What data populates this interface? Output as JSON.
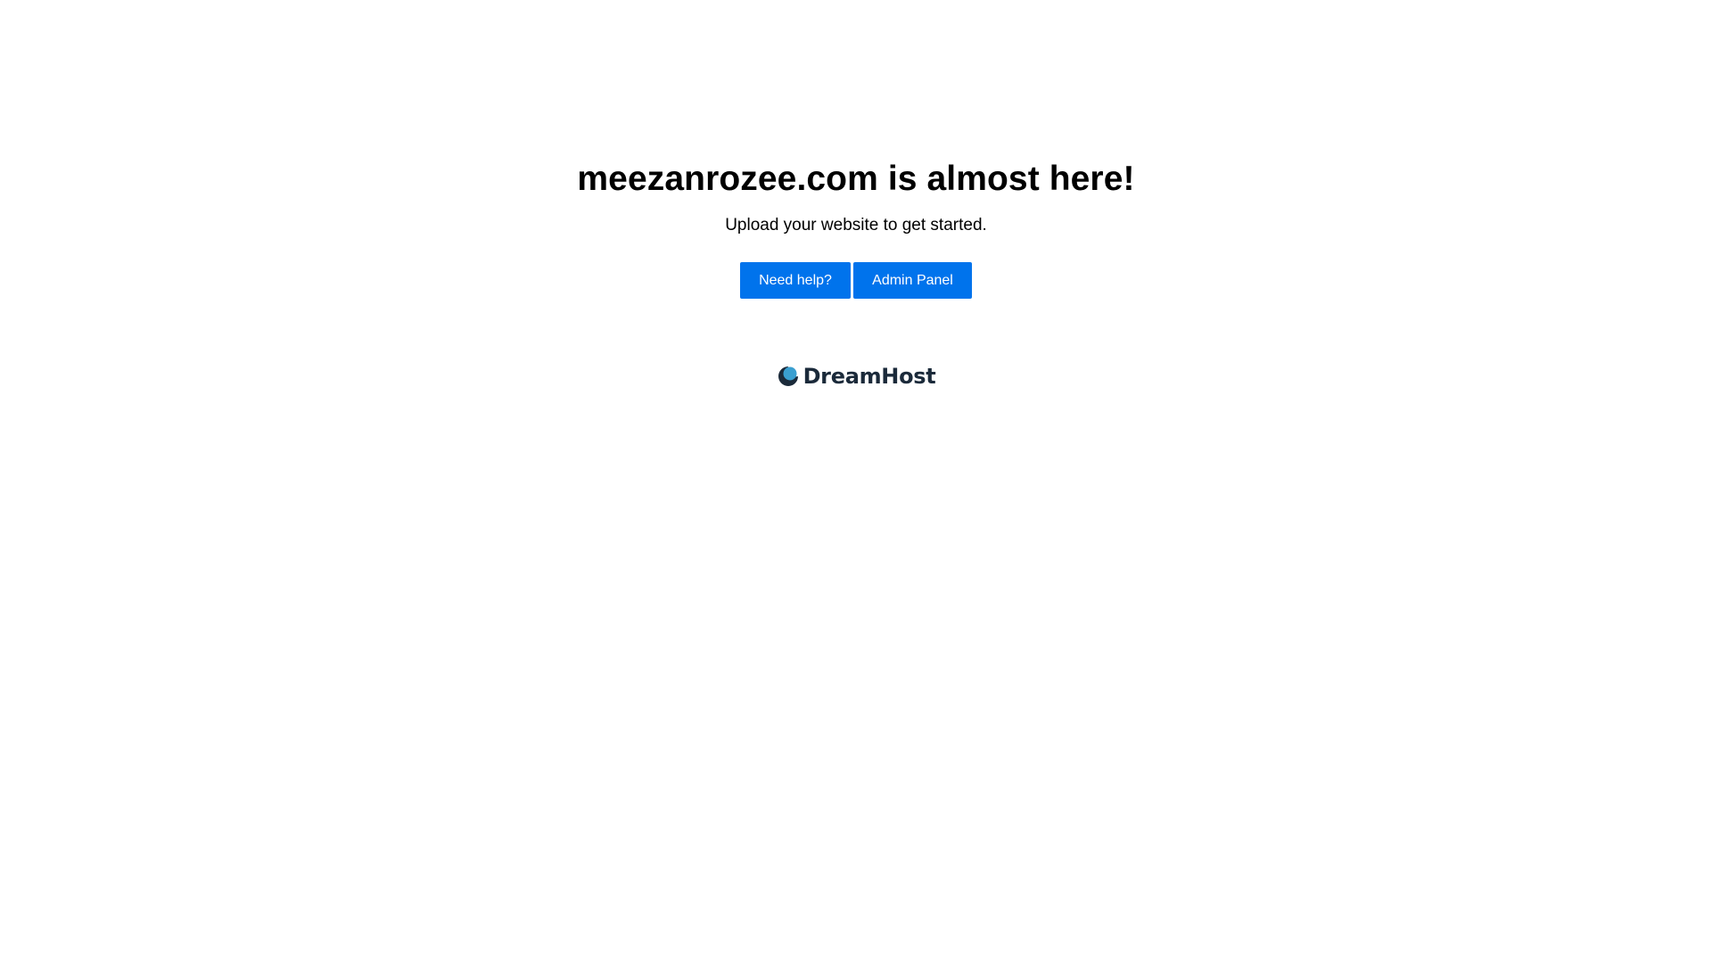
{
  "hero": {
    "title": "meezanrozee.com is almost here!",
    "subtitle": "Upload your website to get started."
  },
  "actions": {
    "help_label": "Need help?",
    "admin_label": "Admin Panel"
  },
  "brand": {
    "logo_icon": "dreamhost-moon-icon",
    "name": "DreamHost",
    "dark_color": "#1b2a3a",
    "accent_color": "#3a9fd0"
  },
  "colors": {
    "button": "#0073ec",
    "button_text": "#ffffff",
    "background": "#ffffff",
    "text": "#000000"
  }
}
